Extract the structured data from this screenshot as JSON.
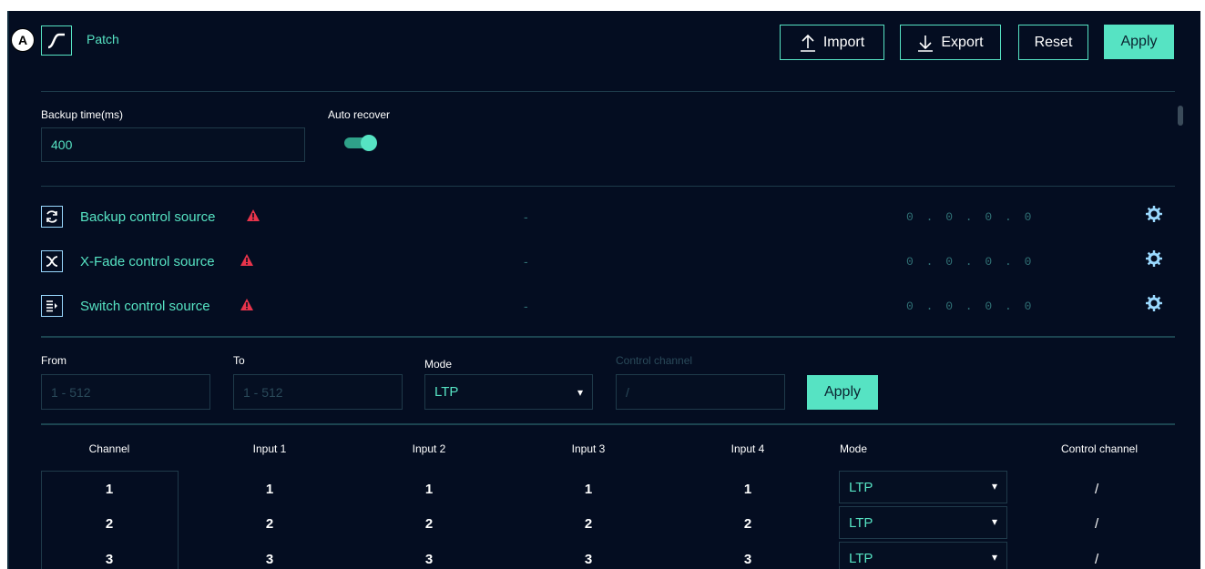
{
  "annotation": {
    "badge": "A"
  },
  "header": {
    "title": "Patch",
    "import_label": "Import",
    "export_label": "Export",
    "reset_label": "Reset",
    "apply_label": "Apply"
  },
  "settings": {
    "backup_time_label": "Backup time(ms)",
    "backup_time_value": "400",
    "auto_recover_label": "Auto recover",
    "auto_recover_on": true
  },
  "control_sources": [
    {
      "label": "Backup control source",
      "icon": "refresh-icon",
      "value": "-",
      "ip": "0 . 0 . 0 . 0"
    },
    {
      "label": "X-Fade control source",
      "icon": "x-fade-icon",
      "value": "-",
      "ip": "0 . 0 . 0 . 0"
    },
    {
      "label": "Switch control source",
      "icon": "switch-icon",
      "value": "-",
      "ip": "0 . 0 . 0 . 0"
    }
  ],
  "range_form": {
    "from_label": "From",
    "from_placeholder": "1 - 512",
    "to_label": "To",
    "to_placeholder": "1 - 512",
    "mode_label": "Mode",
    "mode_value": "LTP",
    "control_channel_label": "Control channel",
    "control_channel_placeholder": "/",
    "apply_label": "Apply"
  },
  "table": {
    "headers": [
      "Channel",
      "Input 1",
      "Input 2",
      "Input 3",
      "Input 4",
      "Mode",
      "Control channel"
    ],
    "rows": [
      {
        "channel": "1",
        "input1": "1",
        "input2": "1",
        "input3": "1",
        "input4": "1",
        "mode": "LTP",
        "control": "/"
      },
      {
        "channel": "2",
        "input1": "2",
        "input2": "2",
        "input3": "2",
        "input4": "2",
        "mode": "LTP",
        "control": "/"
      },
      {
        "channel": "3",
        "input1": "3",
        "input2": "3",
        "input3": "3",
        "input4": "3",
        "mode": "LTP",
        "control": "/"
      }
    ]
  },
  "colors": {
    "background": "#040d21",
    "accent": "#56e3c3",
    "warning": "#e8344b"
  }
}
